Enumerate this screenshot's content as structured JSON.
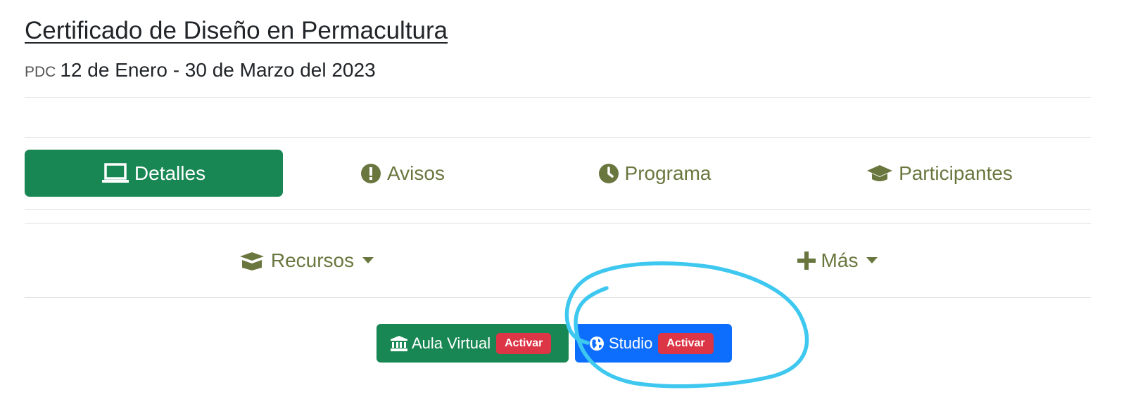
{
  "header": {
    "title": "Certificado de Diseño en Permacultura",
    "abbr": "PDC",
    "dates": "12 de Enero - 30 de Marzo del 2023"
  },
  "tabs": [
    {
      "label": "Detalles",
      "icon": "laptop-icon",
      "active": true
    },
    {
      "label": "Avisos",
      "icon": "exclamation-circle-icon",
      "active": false
    },
    {
      "label": "Programa",
      "icon": "clock-icon",
      "active": false
    },
    {
      "label": "Participantes",
      "icon": "graduation-cap-icon",
      "active": false
    }
  ],
  "menus": [
    {
      "label": "Recursos",
      "icon": "box-open-icon"
    },
    {
      "label": "Más",
      "icon": "plus-icon"
    }
  ],
  "actions": [
    {
      "label": "Aula Virtual",
      "icon": "university-icon",
      "badge": "Activar",
      "color": "#198754"
    },
    {
      "label": "Studio",
      "icon": "globe-icon",
      "badge": "Activar",
      "color": "#0d6efd"
    }
  ],
  "colors": {
    "primary_green": "#198754",
    "primary_blue": "#0d6efd",
    "olive_text": "#69773f",
    "badge_red": "#dc3545",
    "annotation_cyan": "#3ec8f0"
  }
}
